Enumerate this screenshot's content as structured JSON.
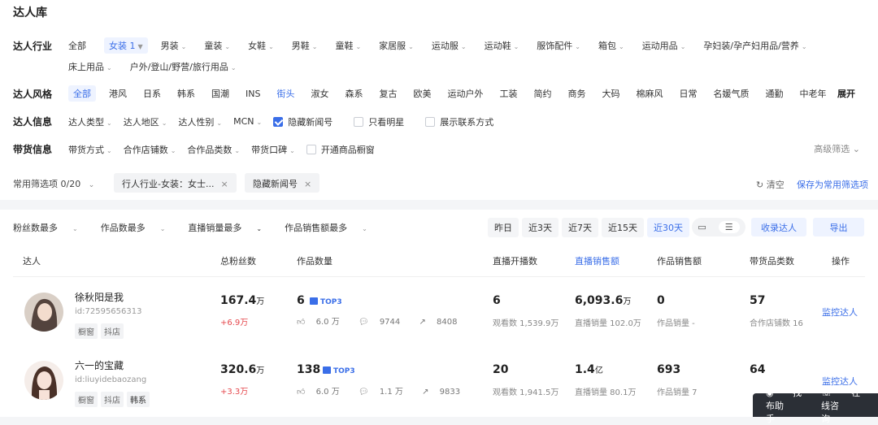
{
  "page_title": "达人库",
  "filters": {
    "industry": {
      "label": "达人行业",
      "options": [
        "全部",
        "女装 1",
        "男装",
        "童装",
        "女鞋",
        "男鞋",
        "童鞋",
        "家居服",
        "运动服",
        "运动鞋",
        "服饰配件",
        "箱包",
        "运动用品",
        "孕妇装/孕产妇用品/营养",
        "床上用品",
        "户外/登山/野营/旅行用品"
      ]
    },
    "style": {
      "label": "达人风格",
      "options": [
        "全部",
        "港风",
        "日系",
        "韩系",
        "国潮",
        "INS",
        "街头",
        "淑女",
        "森系",
        "复古",
        "欧美",
        "运动户外",
        "工装",
        "简约",
        "商务",
        "大码",
        "棉麻风",
        "日常",
        "名媛气质",
        "通勤",
        "中老年"
      ],
      "expand": "展开"
    },
    "info": {
      "label": "达人信息",
      "options": [
        "达人类型",
        "达人地区",
        "达人性别",
        "MCN"
      ],
      "checkboxes": [
        {
          "label": "隐藏新闻号",
          "checked": true
        },
        {
          "label": "只看明星",
          "checked": false
        },
        {
          "label": "展示联系方式",
          "checked": false
        }
      ]
    },
    "goods": {
      "label": "带货信息",
      "options": [
        "带货方式",
        "合作店铺数",
        "合作品类数",
        "带货口碑"
      ],
      "checkbox": {
        "label": "开通商品橱窗",
        "checked": false
      },
      "advanced": "高级筛选"
    },
    "common": "常用筛选项 0/20",
    "tags": [
      "行人行业-女装：女士...",
      "隐藏新闻号"
    ],
    "clear": "清空",
    "save": "保存为常用筛选项"
  },
  "sort": {
    "options": [
      "粉丝数最多",
      "作品数最多",
      "直播销量最多",
      "作品销售额最多"
    ],
    "active": 2
  },
  "dates": [
    "昨日",
    "近3天",
    "近7天",
    "近15天",
    "近30天"
  ],
  "date_active": 4,
  "buttons": {
    "collect": "收录达人",
    "export": "导出"
  },
  "columns": [
    "达人",
    "总粉丝数",
    "作品数量",
    "直播开播数",
    "直播销售额",
    "作品销售额",
    "带货品类数",
    "操作"
  ],
  "rows": [
    {
      "name": "徐秋阳是我",
      "id": "id:72595656313",
      "chips": [
        "橱窗",
        "抖店"
      ],
      "fans": "167.4",
      "fans_unit": "万",
      "fans_change": "+6.9万",
      "works": "6",
      "top3": "TOP3",
      "likes": "6.0 万",
      "comments": "9744",
      "shares": "8408",
      "live_count": "6",
      "live_viewers": "观看数 1,539.9万",
      "live_sales": "6,093.6",
      "live_sales_unit": "万",
      "live_sales_sub": "直播销量 102.0万",
      "work_sales": "0",
      "work_sales_sub": "作品销量 -",
      "categories": "57",
      "categories_sub": "合作店铺数 16",
      "action": "监控达人"
    },
    {
      "name": "六一的宝藏",
      "id": "id:liuyidebaozang",
      "chips": [
        "橱窗",
        "抖店",
        "韩系"
      ],
      "fans": "320.6",
      "fans_unit": "万",
      "fans_change": "+3.3万",
      "works": "138",
      "top3": "TOP3",
      "likes": "6.0 万",
      "comments": "1.1 万",
      "shares": "9833",
      "live_count": "20",
      "live_viewers": "观看数 1,941.5万",
      "live_sales": "1.4",
      "live_sales_unit": "亿",
      "live_sales_sub": "直播销量 80.1万",
      "work_sales": "693",
      "work_sales_sub": "作品销量 7",
      "categories": "64",
      "categories_sub": "",
      "action": "监控达人"
    }
  ],
  "helper": {
    "find": "找布助手",
    "consult": "在线咨询"
  }
}
